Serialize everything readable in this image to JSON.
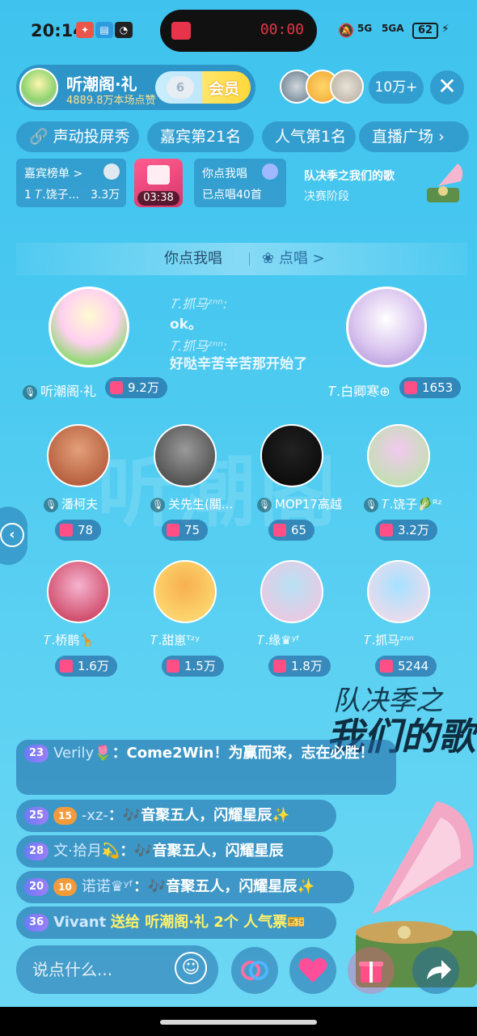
{
  "status_bar": {
    "time": "20:14",
    "record_time": "00:00",
    "network_labels": [
      "5G",
      "5GA"
    ],
    "battery": "62"
  },
  "host": {
    "name": "听潮阁·礼",
    "likes": "4889.8万本场点赞",
    "fan_level": "6",
    "member_label": "会员"
  },
  "viewers": {
    "count": "10万+"
  },
  "chips": {
    "screen_show": "声动投屏秀",
    "guest_rank": "嘉宾第21名",
    "popularity_rank": "人气第1名",
    "live_plaza": "直播广场"
  },
  "info": {
    "guest_list_title": "嘉宾榜单 >",
    "guest_list_top_user": "1 𝑇.饶子...",
    "guest_list_top_value": "3.3万",
    "gift_timer": "03:38",
    "request_title": "你点我唱",
    "request_count": "已点唱40首",
    "match_title": "队决季之我们的歌",
    "match_stage": "决赛阶段"
  },
  "room": {
    "title": "你点我唱",
    "sing_link": "点唱 >"
  },
  "host_seat": {
    "name": "听潮阁·礼",
    "score": "9.2万"
  },
  "guest_seat": {
    "name": "𝑇.白卿寒⊕",
    "score": "1653"
  },
  "mini_chat": [
    {
      "user": "𝑇.抓马ᶻⁿⁿ:",
      "text": "ok。"
    },
    {
      "user": "𝑇.抓马ᶻⁿⁿ:",
      "text": "好哒辛苦辛苦那开始了"
    }
  ],
  "seats_row1": [
    {
      "name": "潘柯夫",
      "score": "78",
      "color1": "#a84a2c",
      "color2": "#e3a07a"
    },
    {
      "name": "关先生(關...",
      "score": "75",
      "color1": "#3a3a3a",
      "color2": "#9a9a9a"
    },
    {
      "name": "MOP17高越",
      "score": "65",
      "color1": "#050505",
      "color2": "#222222"
    },
    {
      "name": "𝑇.饶子🥬ᴿᶻ",
      "score": "3.2万",
      "color1": "#b3e6a0",
      "color2": "#f2c9ef"
    }
  ],
  "seats_row2": [
    {
      "name": "𝑇.桥鹊🦒",
      "score": "1.6万",
      "color1": "#c42a4a",
      "color2": "#f5b4cf"
    },
    {
      "name": "𝑇.甜崽ᵀᶻʸ",
      "score": "1.5万",
      "color1": "#ffe27a",
      "color2": "#f7b04f"
    },
    {
      "name": "𝑇.缘♛ʸᶠ",
      "score": "1.8万",
      "color1": "#f7c1dd",
      "color2": "#b8e2f4"
    },
    {
      "name": "𝑇.抓马ᶻⁿⁿ",
      "score": "5244",
      "color1": "#ffd9e6",
      "color2": "#a6e2ff"
    }
  ],
  "promo": {
    "line1": "队决季之",
    "line2": "我们的歌"
  },
  "messages": [
    {
      "level": "23",
      "user": "Verily🌷",
      "text": "：Come2Win！为赢而来，志在必胜！"
    },
    {
      "level": "25",
      "fan": "15",
      "user": "-xz-",
      "text": "：🎶音聚五人，闪耀星辰✨"
    },
    {
      "level": "28",
      "user": "文·拾月💫",
      "text": "：🎶音聚五人，闪耀星辰"
    },
    {
      "level": "20",
      "fan": "10",
      "user": "诺诺♛ʸᶠ",
      "text": "：🎶音聚五人，闪耀星辰✨"
    },
    {
      "level": "36",
      "user": "Vivant",
      "text": "送给 听潮阁·礼 2个 人气票🎫"
    }
  ],
  "bottom": {
    "input_placeholder": "说点什么..."
  },
  "watermark": "听潮阁",
  "colors": {
    "accent": "#48c8f0",
    "score_icon": "#ff4f86",
    "record_red": "#e8344a"
  }
}
